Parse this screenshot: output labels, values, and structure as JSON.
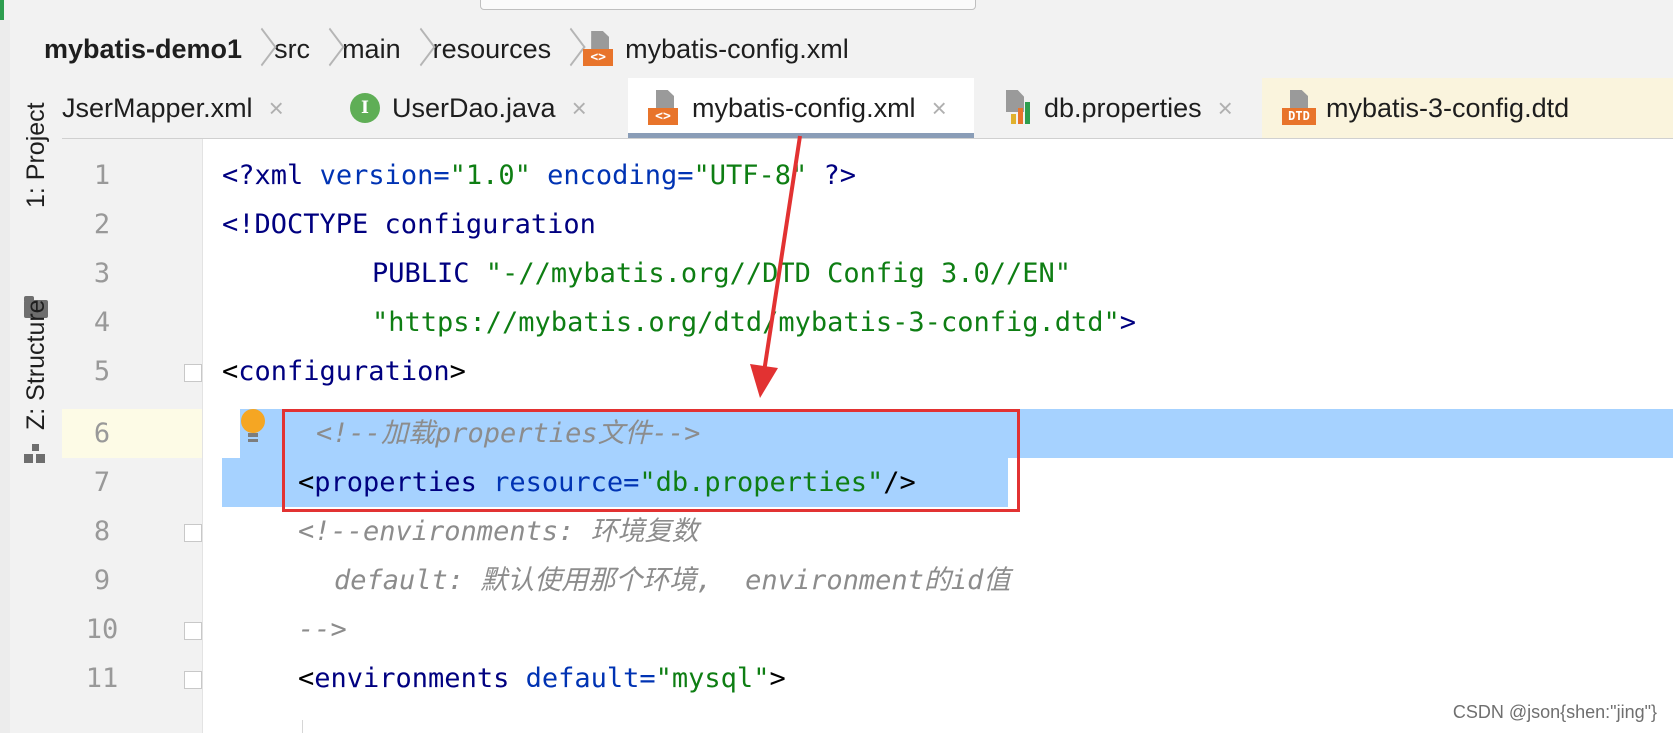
{
  "breadcrumb": {
    "project": "mybatis-demo1",
    "items": [
      "src",
      "main",
      "resources"
    ],
    "file": "mybatis-config.xml"
  },
  "tabs": [
    {
      "label": "UserMapper.xml",
      "visible_label": "JserMapper.xml",
      "icon": "xml-file-icon"
    },
    {
      "label": "UserDao.java",
      "icon": "java-interface-icon",
      "icon_glyph": "I"
    },
    {
      "label": "mybatis-config.xml",
      "icon": "xml-file-icon",
      "active": true
    },
    {
      "label": "db.properties",
      "icon": "properties-file-icon"
    },
    {
      "label": "mybatis-3-config.dtd",
      "icon": "dtd-file-icon",
      "icon_glyph": "DTD"
    }
  ],
  "close_glyph": "×",
  "xml_icon_glyph": "<>",
  "side_tools": {
    "project": "1: Project",
    "structure": "Z: Structure"
  },
  "lines": [
    {
      "n": "1"
    },
    {
      "n": "2"
    },
    {
      "n": "3"
    },
    {
      "n": "4"
    },
    {
      "n": "5"
    },
    {
      "n": "6"
    },
    {
      "n": "7"
    },
    {
      "n": "8"
    },
    {
      "n": "9"
    },
    {
      "n": "10"
    },
    {
      "n": "11"
    }
  ],
  "code": {
    "l1": {
      "open": "<?",
      "tag": "xml",
      "sp1": " ",
      "a1": "version=",
      "v1": "\"1.0\"",
      "sp2": " ",
      "a2": "encoding=",
      "v2": "\"UTF-8\"",
      "close": " ?>"
    },
    "l2": {
      "open": "<!DOCTYPE configuration"
    },
    "l3": {
      "kw": "PUBLIC",
      "str": " \"-//mybatis.org//DTD Config 3.0//EN\""
    },
    "l4": {
      "str": "\"https://mybatis.org/dtd/mybatis-3-config.dtd\"",
      "close": ">"
    },
    "l5": {
      "lt": "<",
      "tag": "configuration",
      "gt": ">"
    },
    "l6": {
      "comment": "<!--加载properties文件-->"
    },
    "l7": {
      "lt": "<",
      "tag": "properties",
      "sp": " ",
      "attr": "resource=",
      "val": "\"db.properties\"",
      "end": "/>"
    },
    "l8": {
      "comment": "<!--environments: 环境复数"
    },
    "l9": {
      "comment": "default: 默认使用那个环境,  environment的id值"
    },
    "l10": {
      "comment": "-->"
    },
    "l11": {
      "lt": "<",
      "tag": "environments",
      "sp": " ",
      "attr": "default=",
      "val": "\"mysql\"",
      "gt": ">"
    }
  },
  "colors": {
    "selection": "#a6d2ff",
    "annotation_red": "#e23232",
    "tag": "#000080",
    "string": "#0e7e13",
    "comment": "#8c8c8c"
  },
  "watermark": "CSDN @json{shen:\"jing\"}"
}
